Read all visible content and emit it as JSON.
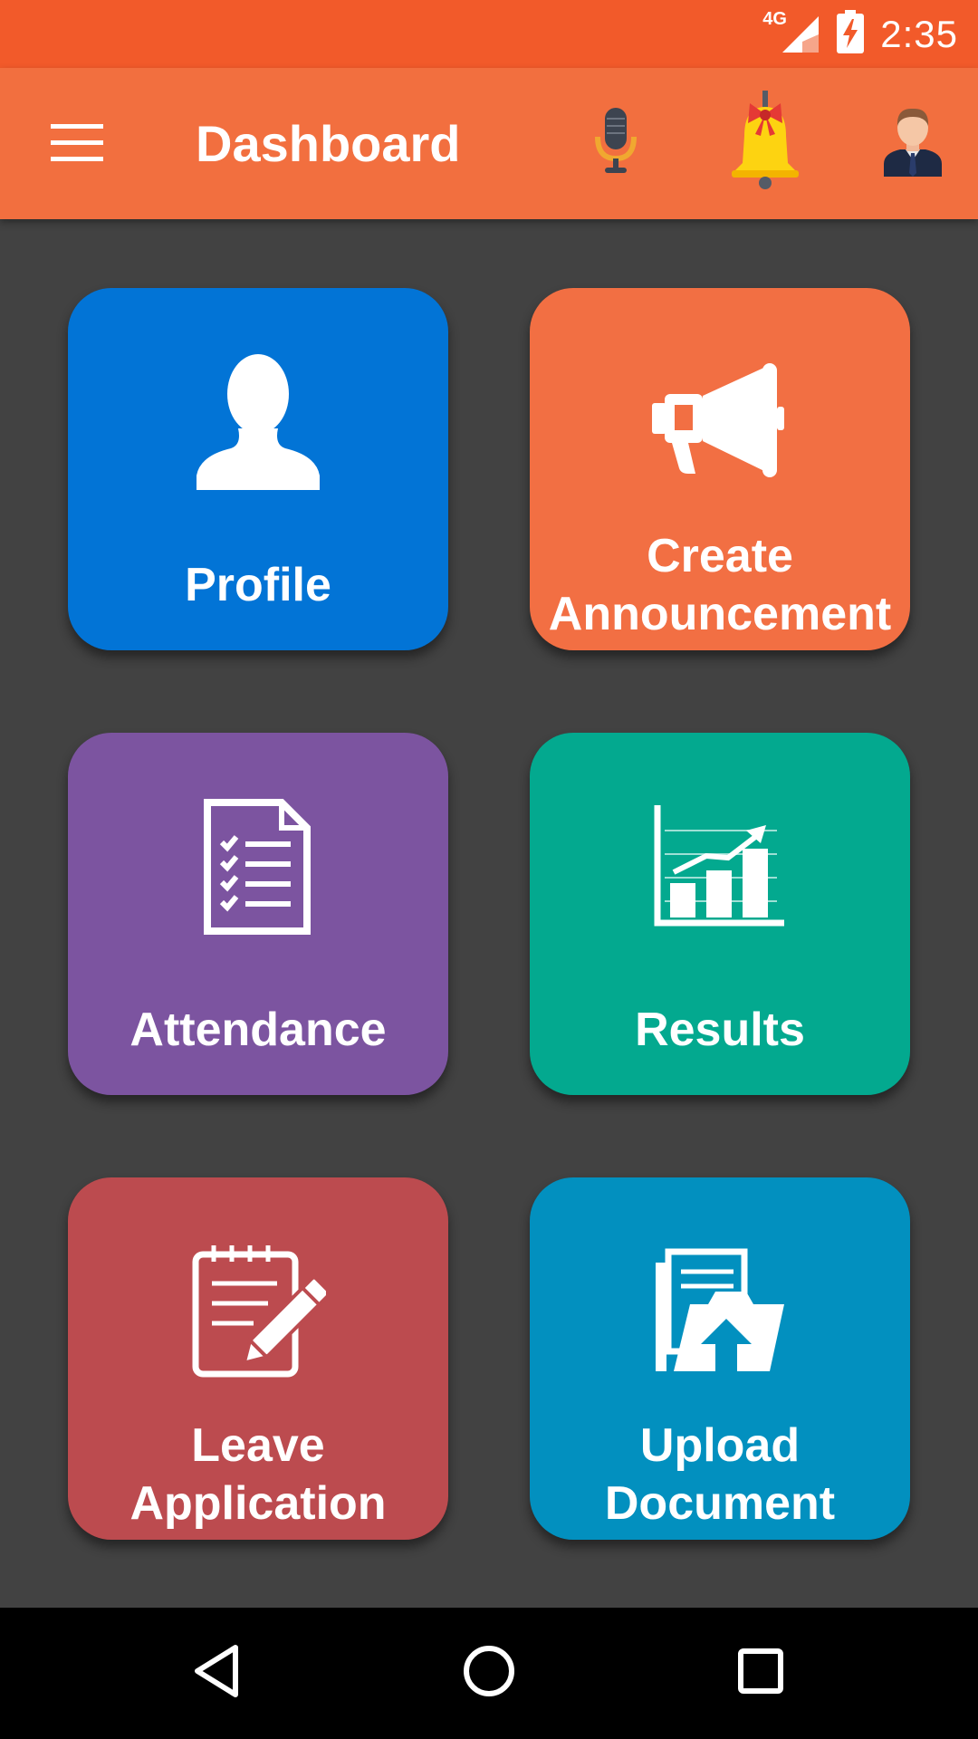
{
  "status_bar": {
    "network_label": "4G",
    "time": "2:35",
    "icons": [
      "signal-icon",
      "battery-charging-icon"
    ]
  },
  "app_bar": {
    "title": "Dashboard",
    "menu_icon": "hamburger-menu-icon",
    "actions": [
      {
        "name": "microphone-button",
        "icon": "microphone-icon"
      },
      {
        "name": "notifications-button",
        "icon": "bell-icon"
      },
      {
        "name": "account-button",
        "icon": "user-avatar-icon"
      }
    ]
  },
  "tiles": [
    {
      "label_lines": [
        "Profile"
      ],
      "icon": "person-icon",
      "color": "#0274d6"
    },
    {
      "label_lines": [
        "Create",
        "Announcement"
      ],
      "icon": "megaphone-icon",
      "color": "#f26f43"
    },
    {
      "label_lines": [
        "Attendance"
      ],
      "icon": "checklist-icon",
      "color": "#7c54a0"
    },
    {
      "label_lines": [
        "Results"
      ],
      "icon": "bar-chart-icon",
      "color": "#03a98f"
    },
    {
      "label_lines": [
        "Leave",
        "Application"
      ],
      "icon": "notepad-pencil-icon",
      "color": "#bc4b4f"
    },
    {
      "label_lines": [
        "Upload",
        "Document"
      ],
      "icon": "folder-upload-icon",
      "color": "#0290bf"
    }
  ],
  "nav_bar": {
    "buttons": [
      {
        "name": "nav-back-button",
        "icon": "back-triangle-icon"
      },
      {
        "name": "nav-home-button",
        "icon": "home-circle-icon"
      },
      {
        "name": "nav-recents-button",
        "icon": "recents-square-icon"
      }
    ]
  }
}
